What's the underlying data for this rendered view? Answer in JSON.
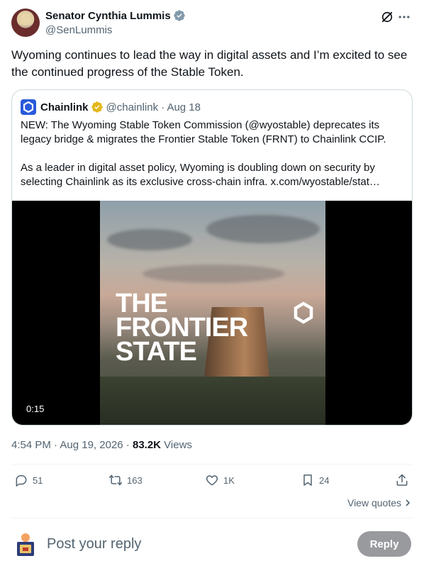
{
  "author": {
    "display_name": "Senator Cynthia Lummis",
    "handle": "@SenLummis",
    "verified_icon": "verified-badge-icon"
  },
  "header_actions": {
    "grok_icon": "grok-icon",
    "more_icon": "more-icon"
  },
  "tweet": {
    "text": "Wyoming continues to lead the way in digital assets and I’m excited to see the continued progress of the Stable Token."
  },
  "quote": {
    "name": "Chainlink",
    "handle": "@chainlink",
    "date": "· Aug 18",
    "paragraph1": "NEW: The Wyoming Stable Token Commission (@wyostable) deprecates its legacy bridge & migrates the Frontier Stable Token (FRNT) to Chainlink CCIP.",
    "paragraph2": "As a leader in digital asset policy, Wyoming is doubling down on security by selecting Chainlink as its exclusive cross-chain infra.  x.com/wyostable/stat…",
    "video": {
      "overlay_line1": "THE",
      "overlay_line2": "FRONTIER",
      "overlay_line3": "STATE",
      "duration": "0:15"
    }
  },
  "meta": {
    "time": "4:54 PM",
    "sep1": " · ",
    "date": "Aug 19, 2026",
    "sep2": " · ",
    "views_count": "83.2K",
    "views_label": " Views"
  },
  "actions": {
    "replies": "51",
    "reposts": "163",
    "likes": "1K",
    "bookmarks": "24"
  },
  "view_quotes": "View quotes",
  "reply": {
    "placeholder": "Post your reply",
    "button": "Reply"
  },
  "colors": {
    "text_primary": "#0f1419",
    "text_secondary": "#536471",
    "verified_blue": "#1d9bf0",
    "chainlink_blue": "#2a5ada",
    "gold_badge": "#e2b719"
  }
}
